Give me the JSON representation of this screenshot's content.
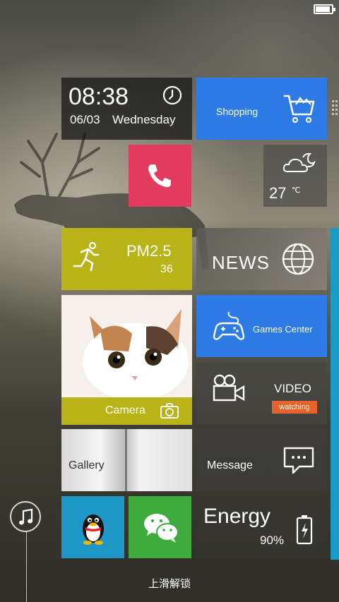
{
  "status_bar": {
    "battery_level": 0.9
  },
  "clock": {
    "time": "08:38",
    "date": "06/03",
    "weekday": "Wednesday"
  },
  "tiles": {
    "shopping": {
      "label": "Shopping",
      "color": "#2f7be6"
    },
    "phone": {
      "color": "#e23b5e"
    },
    "weather": {
      "temperature": "27",
      "unit": "℃"
    },
    "pm25": {
      "label": "PM2.5",
      "value": "36",
      "color": "#b8b316"
    },
    "news": {
      "label": "NEWS"
    },
    "games": {
      "label": "Games Center",
      "color": "#2f7be6"
    },
    "camera": {
      "label": "Camera",
      "color": "#b8b316"
    },
    "video": {
      "label": "VIDEO",
      "badge": "watching",
      "badge_color": "#e8632b"
    },
    "gallery": {
      "label": "Gallery"
    },
    "message": {
      "label": "Message"
    },
    "qq": {
      "color": "#1e97c6"
    },
    "wechat": {
      "color": "#3eab3e"
    },
    "energy": {
      "label": "Energy",
      "value": "90%"
    }
  },
  "unlock": {
    "hint": "上滑解锁"
  }
}
